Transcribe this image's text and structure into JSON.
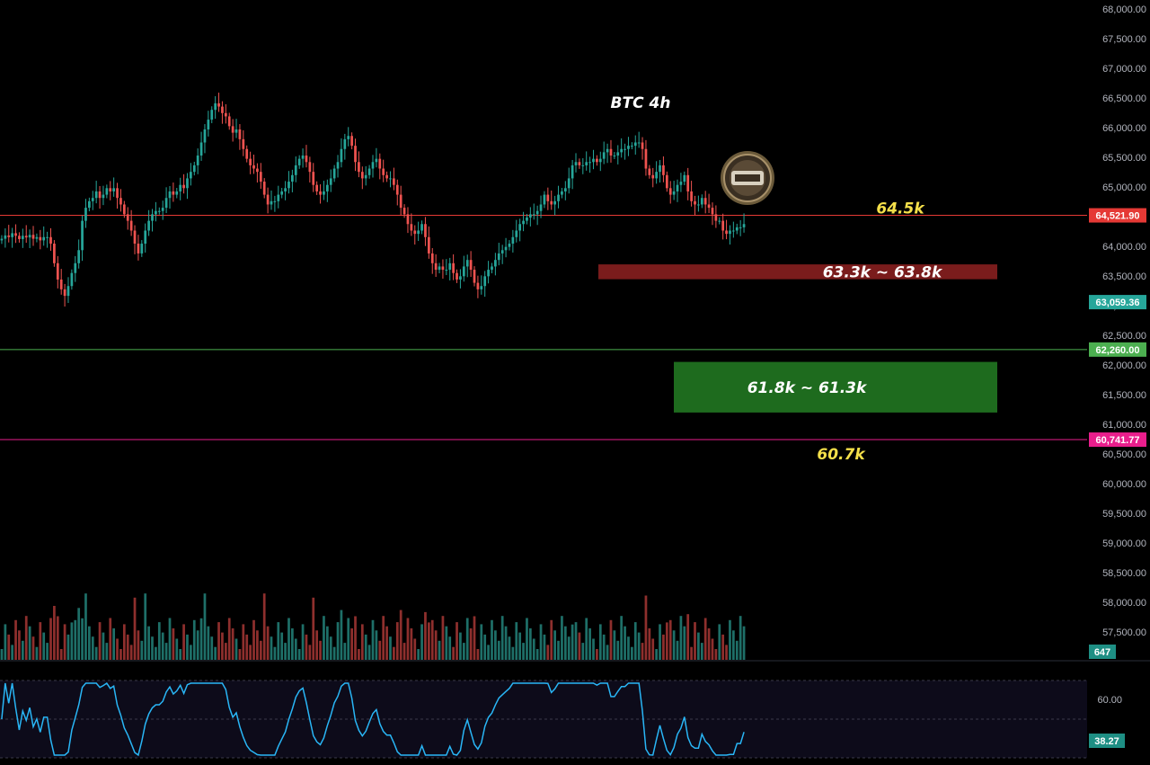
{
  "chart_data": {
    "type": "candlestick",
    "title": "BTC 4h",
    "price_axis": {
      "ticks": [
        "68,000.00",
        "67,500.00",
        "67,000.00",
        "66,500.00",
        "66,000.00",
        "65,500.00",
        "65,000.00",
        "64,500.00",
        "64,000.00",
        "63,500.00",
        "63,000.00",
        "62,500.00",
        "62,000.00",
        "61,500.00",
        "61,000.00",
        "60,500.00",
        "60,000.00",
        "59,500.00",
        "59,000.00",
        "58,500.00",
        "58,000.00",
        "57,500.00"
      ],
      "range": [
        57000,
        68000
      ]
    },
    "horizontal_levels": [
      {
        "price": 64521.9,
        "badge": "64,521.90",
        "color": "#e53935",
        "label": "64.5k",
        "label_color": "#f5e04a"
      },
      {
        "price": 62260.0,
        "badge": "62,260.00",
        "color": "#4caf50",
        "label": "",
        "label_color": ""
      },
      {
        "price": 60741.77,
        "badge": "60,741.77",
        "color": "#e91e8c",
        "label": "60.7k",
        "label_color": "#f5e04a"
      }
    ],
    "last_price": {
      "price": 63059.36,
      "badge": "63,059.36",
      "color": "#26a69a"
    },
    "zones": [
      {
        "label": "63.3k ~ 63.8k",
        "low": 63400,
        "high": 63650,
        "color": "#7a1c1c"
      },
      {
        "label": "61.8k ~ 61.3k",
        "low": 61350,
        "high": 61900,
        "color": "#1e6b1e"
      }
    ],
    "volume": {
      "last_value": "647"
    },
    "rsi": {
      "ticks": [
        "60.00"
      ],
      "last_value": "38.27"
    },
    "series": {
      "start_price": 64100,
      "moves": [
        0.05,
        0.1,
        -0.05,
        0.12,
        -0.08,
        -0.1,
        0.1,
        -0.05,
        0.08,
        -0.12,
        0.05,
        -0.1,
        0.1,
        0.0,
        -0.2,
        -0.6,
        -0.5,
        -0.3,
        -0.2,
        0.3,
        0.4,
        0.3,
        0.4,
        0.9,
        0.4,
        0.2,
        0.1,
        0.2,
        -0.2,
        0.1,
        0.2,
        -0.1,
        0.1,
        -0.3,
        -0.2,
        -0.3,
        -0.2,
        -0.3,
        -0.4,
        -0.3,
        0.3,
        0.4,
        0.3,
        0.2,
        0.1,
        0.0,
        0.1,
        0.3,
        0.2,
        -0.1,
        0.1,
        0.2,
        -0.1,
        0.3,
        0.2,
        0.2,
        0.3,
        0.4,
        0.4,
        0.3,
        0.3,
        0.2,
        -0.1,
        -0.2,
        -0.1,
        -0.3,
        -0.2,
        0.1,
        -0.3,
        -0.3,
        -0.3,
        -0.2,
        -0.1,
        -0.1,
        -0.3,
        -0.4,
        -0.3,
        0.1,
        0.0,
        0.2,
        0.1,
        0.1,
        0.2,
        0.2,
        0.3,
        0.2,
        0.1,
        -0.2,
        -0.3,
        -0.4,
        -0.2,
        -0.1,
        0.1,
        0.2,
        0.2,
        0.3,
        0.2,
        0.4,
        0.3,
        0.1,
        -0.3,
        -0.5,
        -0.3,
        -0.2,
        0.1,
        0.2,
        0.2,
        0.1,
        -0.3,
        -0.2,
        -0.1,
        0.0,
        -0.2,
        -0.3,
        -0.4,
        -0.2,
        -0.3,
        -0.2,
        -0.1,
        0.1,
        0.2,
        -0.4,
        -0.5,
        -0.3,
        -0.2,
        0.1,
        -0.1,
        0.0,
        0.2,
        -0.3,
        -0.2,
        0.1,
        0.3,
        0.2,
        -0.3,
        -0.4,
        -0.2,
        0.1,
        0.3,
        0.2,
        0.1,
        0.2,
        0.2,
        0.1,
        0.1,
        0.1,
        0.2,
        0.2,
        0.2,
        0.1,
        0.1,
        0.1,
        0.0,
        0.1,
        0.2,
        0.3,
        -0.2,
        -0.1,
        0.1,
        0.2,
        0.1,
        0.1,
        0.3,
        0.4,
        0.1,
        -0.1,
        0.0,
        0.1,
        0.0,
        0.1,
        -0.1,
        0.1,
        0.2,
        0.1,
        -0.2,
        0.0,
        0.1,
        0.1,
        0.0,
        0.1,
        0.0,
        0.1,
        0.0,
        -0.2,
        -0.6,
        -0.2,
        -0.1,
        0.2,
        0.2,
        -0.3,
        -0.4,
        -0.2,
        0.1,
        0.2,
        0.1,
        0.2,
        -0.5,
        -0.3,
        -0.1,
        0.0,
        0.2,
        -0.2,
        -0.1,
        -0.2,
        -0.2,
        0.0,
        -0.3,
        -0.1,
        0.1,
        0.0,
        0.1,
        0.0,
        0.1
      ]
    }
  }
}
